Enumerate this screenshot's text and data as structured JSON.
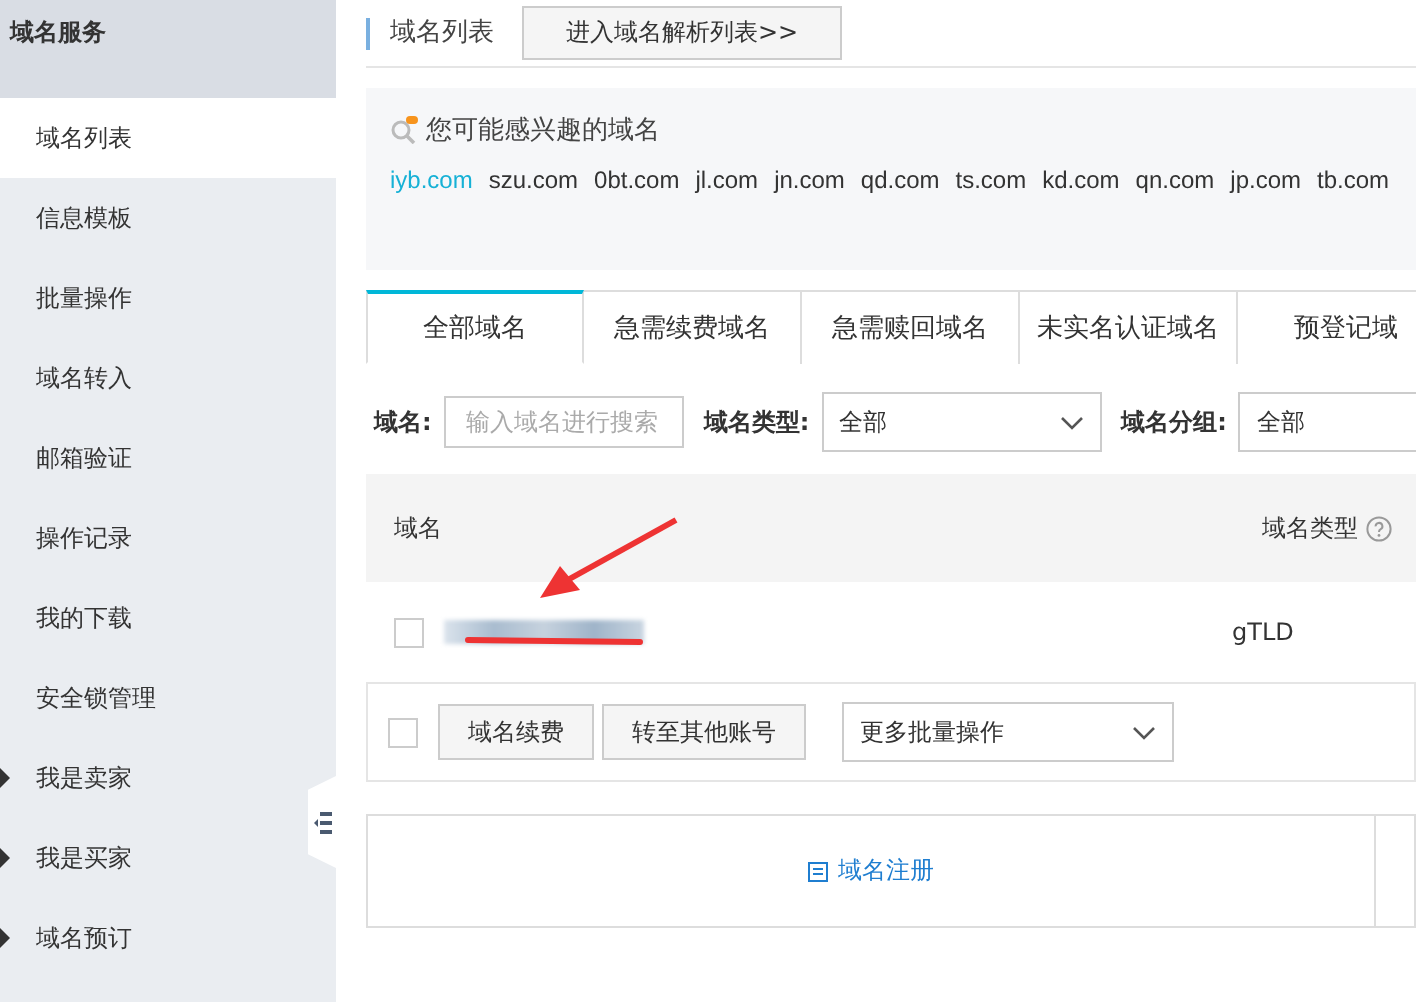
{
  "sidebar": {
    "title": "域名服务",
    "items": [
      {
        "label": "域名列表",
        "kind": "link",
        "selected": true
      },
      {
        "label": "信息模板",
        "kind": "link",
        "selected": false
      },
      {
        "label": "批量操作",
        "kind": "link",
        "selected": false
      },
      {
        "label": "域名转入",
        "kind": "link",
        "selected": false
      },
      {
        "label": "邮箱验证",
        "kind": "link",
        "selected": false
      },
      {
        "label": "操作记录",
        "kind": "link",
        "selected": false
      },
      {
        "label": "我的下载",
        "kind": "link",
        "selected": false
      },
      {
        "label": "安全锁管理",
        "kind": "link",
        "selected": false
      },
      {
        "label": "我是卖家",
        "kind": "group",
        "selected": false
      },
      {
        "label": "我是买家",
        "kind": "group",
        "selected": false
      },
      {
        "label": "域名预订",
        "kind": "group",
        "selected": false
      }
    ]
  },
  "header": {
    "title": "域名列表",
    "button": "进入域名解析列表>>"
  },
  "suggest": {
    "title": "您可能感兴趣的域名",
    "domains": [
      {
        "label": "iyb.com",
        "selected": true
      },
      {
        "label": "szu.com",
        "selected": false
      },
      {
        "label": "0bt.com",
        "selected": false
      },
      {
        "label": "jl.com",
        "selected": false
      },
      {
        "label": "jn.com",
        "selected": false
      },
      {
        "label": "qd.com",
        "selected": false
      },
      {
        "label": "ts.com",
        "selected": false
      },
      {
        "label": "kd.com",
        "selected": false
      },
      {
        "label": "qn.com",
        "selected": false
      },
      {
        "label": "jp.com",
        "selected": false
      },
      {
        "label": "tb.com",
        "selected": false
      }
    ]
  },
  "tabs": [
    {
      "label": "全部域名",
      "selected": true
    },
    {
      "label": "急需续费域名",
      "selected": false
    },
    {
      "label": "急需赎回域名",
      "selected": false
    },
    {
      "label": "未实名认证域名",
      "selected": false
    },
    {
      "label": "预登记域",
      "selected": false
    }
  ],
  "filters": [
    {
      "kind": "search",
      "label": "域名:",
      "placeholder": "输入域名进行搜索"
    },
    {
      "kind": "select",
      "label": "域名类型:",
      "value": "全部"
    },
    {
      "kind": "select",
      "label": "域名分组:",
      "value": "全部"
    }
  ],
  "table": {
    "columns": [
      "域名",
      "域名类型"
    ],
    "rows": [
      {
        "checked": false,
        "type": "gTLD"
      }
    ]
  },
  "batch": {
    "checked": false,
    "buttons": [
      "域名续费",
      "转至其他账号"
    ],
    "select": "更多批量操作"
  },
  "register": {
    "label": "域名注册"
  }
}
